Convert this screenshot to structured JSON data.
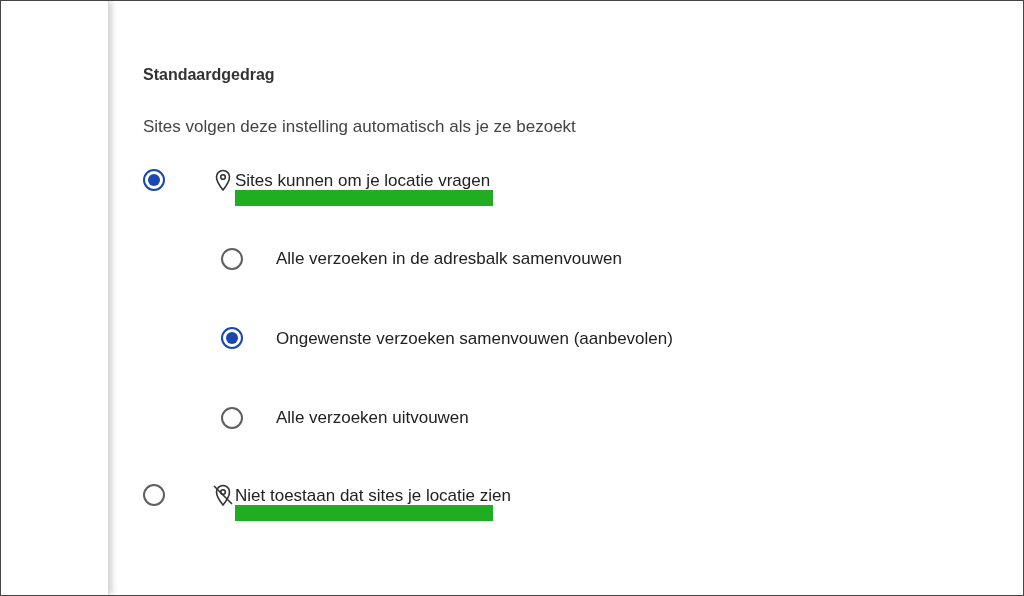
{
  "section": {
    "title": "Standaardgedrag",
    "description": "Sites volgen deze instelling automatisch als je ze bezoekt"
  },
  "options": [
    {
      "kind": "allow",
      "label": "Sites kunnen om je locatie vragen",
      "selected": true,
      "highlighted": true,
      "children": [
        {
          "label": "Alle verzoeken in de adresbalk samenvouwen",
          "selected": false
        },
        {
          "label": "Ongewenste verzoeken samenvouwen (aanbevolen)",
          "selected": true
        },
        {
          "label": "Alle verzoeken uitvouwen",
          "selected": false
        }
      ]
    },
    {
      "kind": "block",
      "label": "Niet toestaan dat sites je locatie zien",
      "selected": false,
      "highlighted": true
    }
  ]
}
